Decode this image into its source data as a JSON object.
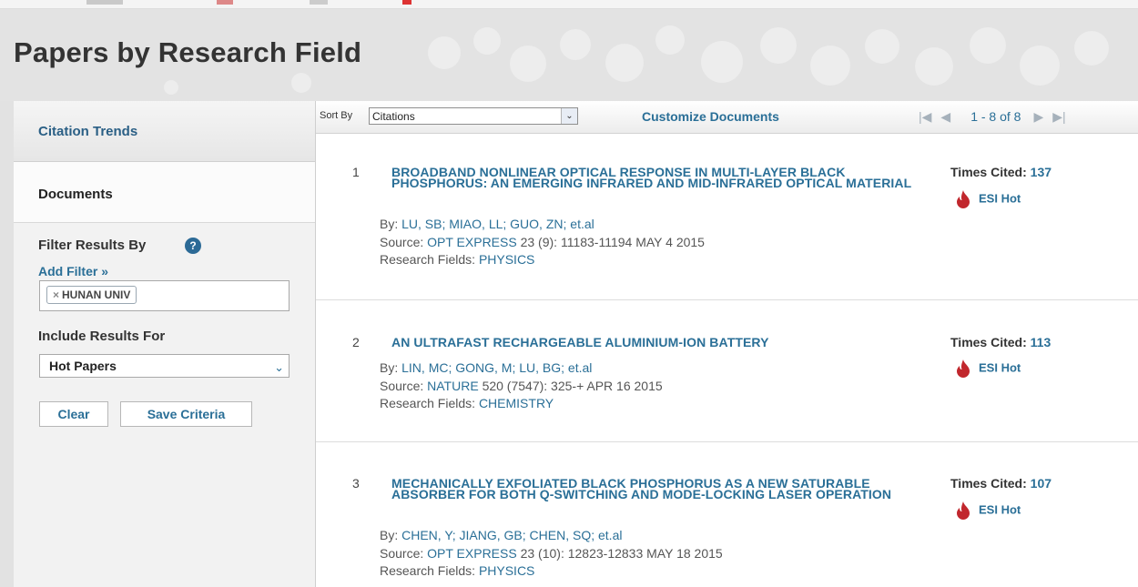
{
  "colors": {
    "link": "#2a6f97",
    "hot": "#c1272d",
    "help": "#2c6a96"
  },
  "header": {
    "title": "Papers by Research Field"
  },
  "sidebar": {
    "tabs": [
      {
        "label": "Citation Trends"
      },
      {
        "label": "Documents"
      }
    ],
    "filter": {
      "title": "Filter Results By",
      "help_icon": "?",
      "add_label": "Add Filter »",
      "chips": [
        {
          "label": "HUNAN UNIV",
          "remove": "×"
        }
      ]
    },
    "include": {
      "title": "Include Results For",
      "selected": "Hot Papers",
      "arrow": "⌄"
    },
    "buttons": {
      "clear": "Clear",
      "save": "Save Criteria"
    }
  },
  "toolbar": {
    "sort_label": "Sort By",
    "sort_value": "Citations",
    "sort_arrow": "⌄",
    "customize": "Customize Documents",
    "pager": {
      "first": "|◀",
      "prev": "◀",
      "range": "1 - 8 of 8",
      "next": "▶",
      "last": "▶|"
    }
  },
  "documents": [
    {
      "index": "1",
      "title": "BROADBAND NONLINEAR OPTICAL RESPONSE IN MULTI-LAYER BLACK PHOSPHORUS: AN EMERGING INFRARED AND MID-INFRARED OPTICAL MATERIAL",
      "by_label": "By:",
      "authors": "LU, SB;  MIAO, LL;  GUO, ZN;  et.al",
      "source_label": "Source:",
      "source_journal": "OPT EXPRESS",
      "source_detail": "23 (9): 11183-11194 MAY 4 2015",
      "fields_label": "Research Fields:",
      "fields": "PHYSICS",
      "cited_label": "Times Cited:",
      "cited": "137",
      "badge": "ESI Hot"
    },
    {
      "index": "2",
      "title": "AN ULTRAFAST RECHARGEABLE ALUMINIUM-ION BATTERY",
      "by_label": "By:",
      "authors": "LIN, MC;  GONG, M;  LU, BG;  et.al",
      "source_label": "Source:",
      "source_journal": "NATURE",
      "source_detail": "520 (7547): 325-+ APR 16 2015",
      "fields_label": "Research Fields:",
      "fields": "CHEMISTRY",
      "cited_label": "Times Cited:",
      "cited": "113",
      "badge": "ESI Hot"
    },
    {
      "index": "3",
      "title": "MECHANICALLY EXFOLIATED BLACK PHOSPHORUS AS A NEW SATURABLE ABSORBER FOR BOTH Q-SWITCHING AND MODE-LOCKING LASER OPERATION",
      "by_label": "By:",
      "authors": "CHEN, Y;  JIANG, GB;  CHEN, SQ;  et.al",
      "source_label": "Source:",
      "source_journal": "OPT EXPRESS",
      "source_detail": "23 (10): 12823-12833 MAY 18 2015",
      "fields_label": "Research Fields:",
      "fields": "PHYSICS",
      "cited_label": "Times Cited:",
      "cited": "107",
      "badge": "ESI Hot"
    }
  ]
}
